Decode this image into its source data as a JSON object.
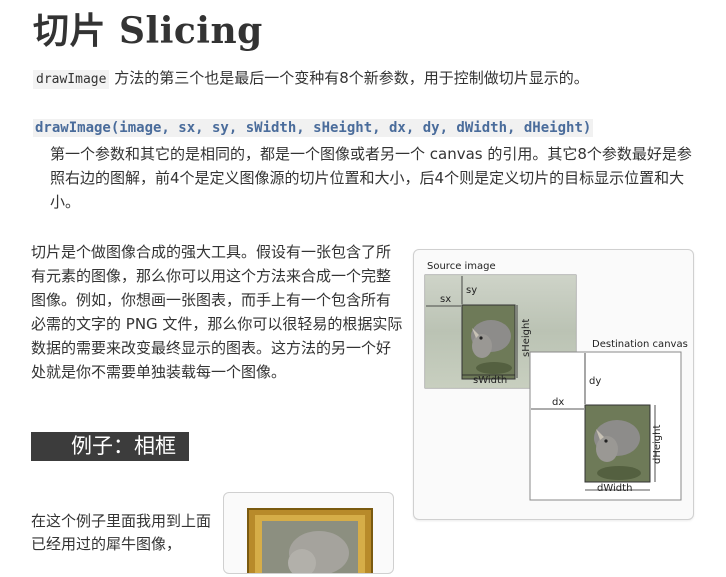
{
  "heading": "切片 Slicing",
  "intro": {
    "code": "drawImage",
    "text": " 方法的第三个也是最后一个变种有8个新参数，用于控制做切片显示的。"
  },
  "signature": "drawImage(image, sx, sy, sWidth, sHeight, dx, dy, dWidth, dHeight)",
  "description": "第一个参数和其它的是相同的，都是一个图像或者另一个 canvas 的引用。其它8个参数最好是参照右边的图解，前4个是定义图像源的切片位置和大小，后4个则是定义切片的目标显示位置和大小。",
  "paragraph": "切片是个做图像合成的强大工具。假设有一张包含了所有元素的图像，那么你可以用这个方法来合成一个完整图像。例如，你想画一张图表，而手上有一个包含所有必需的文字的 PNG 文件，那么你可以很轻易的根据实际数据的需要来改变最终显示的图表。这方法的另一个好处就是你不需要单独装载每一个图像。",
  "section_heading": "例子：相框",
  "example_text": "在这个例子里面我用到上面已经用过的犀牛图像，",
  "diagram": {
    "source_label": "Source image",
    "dest_label": "Destination canvas",
    "sx": "sx",
    "sy": "sy",
    "sWidth": "sWidth",
    "sHeight": "sHeight",
    "dx": "dx",
    "dy": "dy",
    "dWidth": "dWidth",
    "dHeight": "dHeight"
  }
}
